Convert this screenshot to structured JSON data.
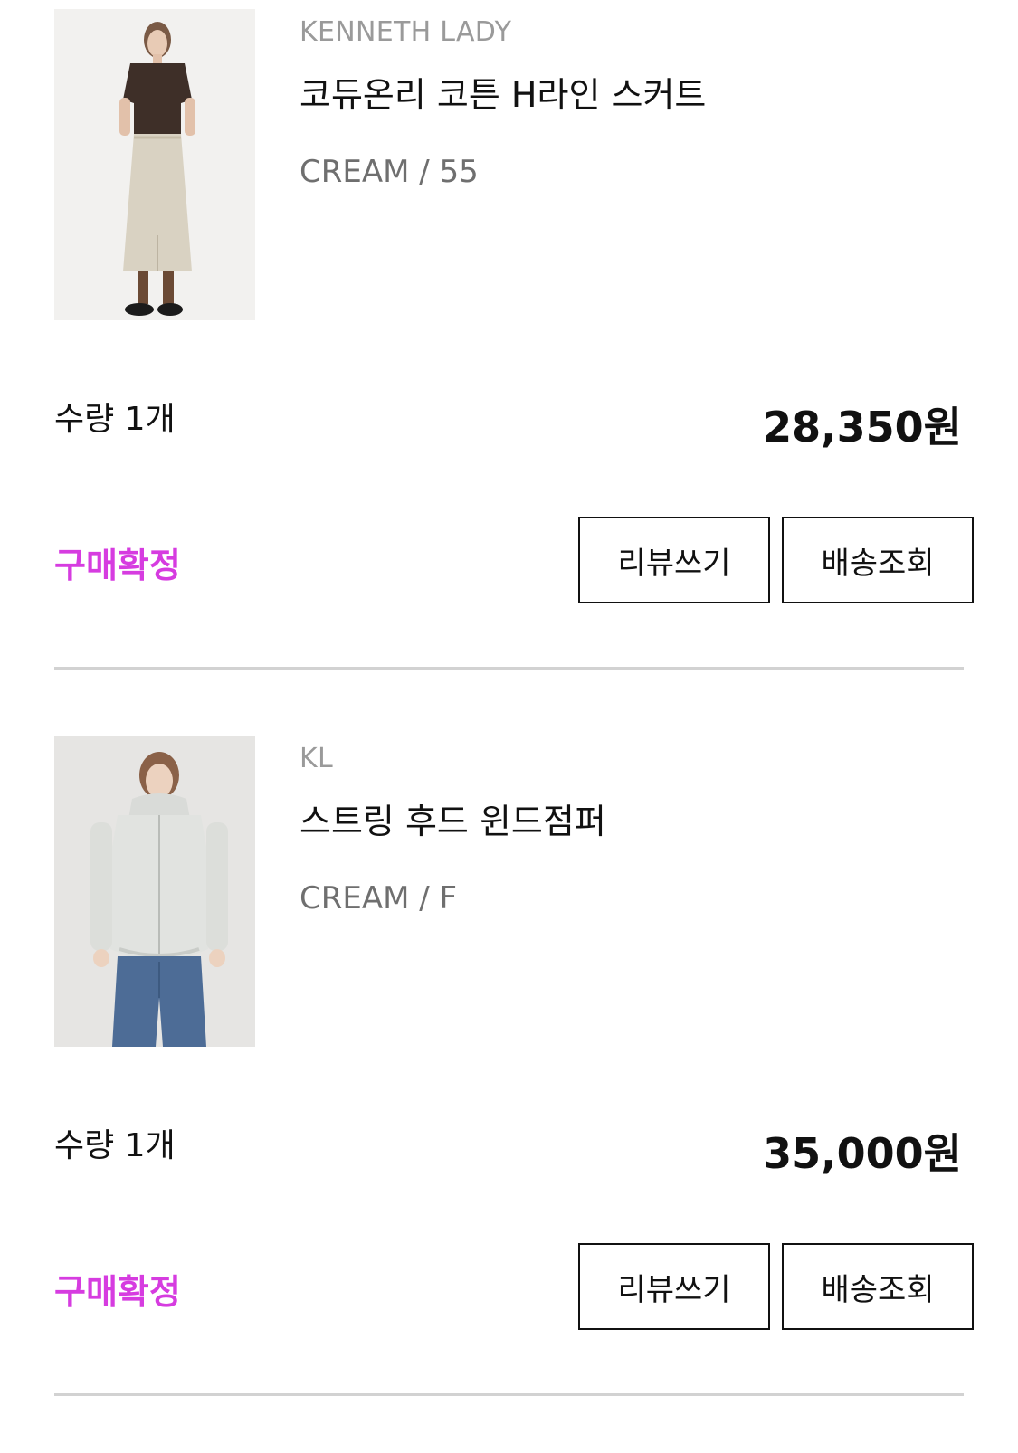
{
  "orders": [
    {
      "brand": "KENNETH LADY",
      "product_name": "코듀온리 코튼 H라인 스커트",
      "option": "CREAM / 55",
      "quantity": "수량 1개",
      "price": "28,350원",
      "status": "구매확정",
      "review_label": "리뷰쓰기",
      "tracking_label": "배송조회",
      "image": "product-photo-skirt"
    },
    {
      "brand": "KL",
      "product_name": "스트링 후드 윈드점퍼",
      "option": "CREAM / F",
      "quantity": "수량 1개",
      "price": "35,000원",
      "status": "구매확정",
      "review_label": "리뷰쓰기",
      "tracking_label": "배송조회",
      "image": "product-photo-jacket"
    }
  ],
  "colors": {
    "status": "#d63ce0",
    "brand_text": "#9a9a9a",
    "option_text": "#6f6f6f",
    "divider": "#d2d2d2",
    "button_border": "#111111"
  }
}
